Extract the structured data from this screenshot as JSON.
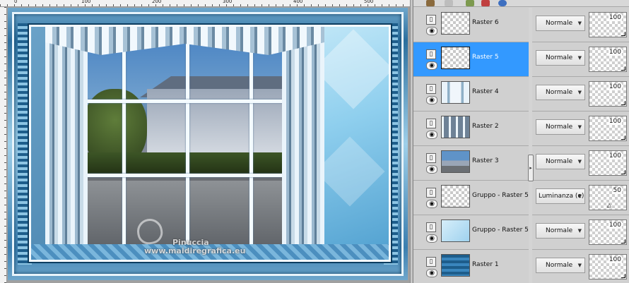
{
  "ruler": {
    "top_labels": [
      "0",
      "100",
      "200",
      "300",
      "400",
      "500",
      "600",
      "700"
    ],
    "left_labels": [
      "1",
      "2",
      "3",
      "4",
      "5",
      "6",
      "7",
      "8",
      "9",
      "0"
    ]
  },
  "canvas": {
    "watermark_line1": "Pinuccia",
    "watermark_line2": "www.maidiregrafica.eu"
  },
  "layers": [
    {
      "name": "Raster 6",
      "blend_mode": "Normale",
      "opacity": "100",
      "visible": true,
      "selected": false,
      "thumb": "transparent"
    },
    {
      "name": "Raster 5",
      "blend_mode": "Normale",
      "opacity": "100",
      "visible": true,
      "selected": true,
      "thumb": "transparent"
    },
    {
      "name": "Raster 4",
      "blend_mode": "Normale",
      "opacity": "100",
      "visible": true,
      "selected": false,
      "thumb": "curtains"
    },
    {
      "name": "Raster 2",
      "blend_mode": "Normale",
      "opacity": "100",
      "visible": true,
      "selected": false,
      "thumb": "window-grid"
    },
    {
      "name": "Raster 3",
      "blend_mode": "Normale",
      "opacity": "100",
      "visible": true,
      "selected": false,
      "thumb": "photo"
    },
    {
      "name": "Gruppo - Raster 5",
      "blend_mode": "Luminanza (e)",
      "opacity": "50",
      "visible": true,
      "selected": false,
      "thumb": "transparent"
    },
    {
      "name": "Gruppo - Raster 5",
      "blend_mode": "Normale",
      "opacity": "100",
      "visible": true,
      "selected": false,
      "thumb": "light-blue"
    },
    {
      "name": "Raster 1",
      "blend_mode": "Normale",
      "opacity": "100",
      "visible": true,
      "selected": false,
      "thumb": "dark-blue"
    }
  ],
  "icons": {
    "visibility": "eye-icon",
    "lock": "layer-lock-icon",
    "dropdown": "chevron-down-icon",
    "collapse": "collapse-arrow-icon"
  },
  "colors": {
    "selected_row": "#3399ff",
    "panel_bg": "#d0d0d0"
  }
}
